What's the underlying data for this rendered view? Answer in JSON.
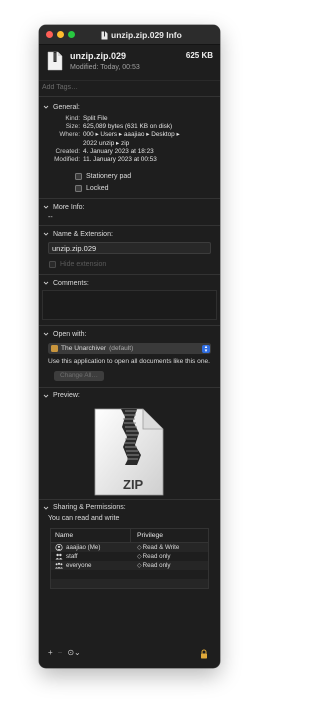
{
  "window": {
    "title": "unzip.zip.029 Info",
    "traffic_lights": {
      "close": "#ff5f57",
      "minimize": "#febc2e",
      "zoom": "#28c840"
    }
  },
  "header": {
    "filename": "unzip.zip.029",
    "size": "625 KB",
    "modified": "Modified: Today, 00:53",
    "icon": "zip-file-icon"
  },
  "tags": {
    "placeholder": "Add Tags…"
  },
  "general": {
    "title": "General:",
    "rows": [
      {
        "key": "Kind:",
        "value": "Split File"
      },
      {
        "key": "Size:",
        "value": "625,089 bytes (631 KB on disk)"
      },
      {
        "key": "Where:",
        "value": "000 ▸ Users ▸ aaajiao ▸ Desktop ▸"
      },
      {
        "key": "",
        "value": "2022 unzip ▸ zip"
      },
      {
        "key": "Created:",
        "value": "4. January 2023 at 18:23"
      },
      {
        "key": "Modified:",
        "value": "11. January 2023 at 00:53"
      }
    ],
    "stationery_label": "Stationery pad",
    "locked_label": "Locked"
  },
  "more_info": {
    "title": "More Info:",
    "value": "--"
  },
  "name_ext": {
    "title": "Name & Extension:",
    "value": "unzip.zip.029",
    "hide_extension_label": "Hide extension"
  },
  "comments": {
    "title": "Comments:"
  },
  "open_with": {
    "title": "Open with:",
    "app": "The Unarchiver",
    "app_suffix": "(default)",
    "description": "Use this application to open all documents like this one.",
    "change_all": "Change All…"
  },
  "preview": {
    "title": "Preview:",
    "label": "ZIP"
  },
  "sharing": {
    "title": "Sharing & Permissions:",
    "subtitle": "You can read and write",
    "col_name": "Name",
    "col_privilege": "Privilege",
    "rows": [
      {
        "name": "aaajiao (Me)",
        "privilege": "Read & Write",
        "icon": "user-icon"
      },
      {
        "name": "staff",
        "privilege": "Read only",
        "icon": "group-icon"
      },
      {
        "name": "everyone",
        "privilege": "Read only",
        "icon": "everyone-icon"
      }
    ]
  },
  "bottom": {
    "add": "+",
    "remove": "−",
    "action": "⊙⌄"
  }
}
